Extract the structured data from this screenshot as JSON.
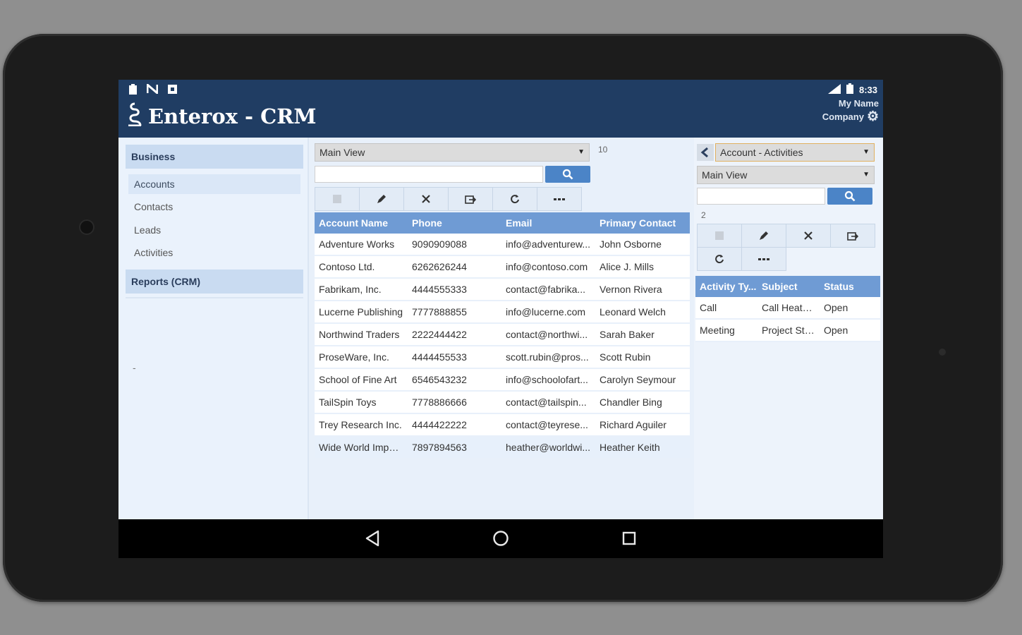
{
  "status_bar": {
    "time": "8:33",
    "left_icons": [
      "clipboard-icon",
      "n-icon",
      "square-icon"
    ],
    "right_icons": [
      "signal-icon",
      "battery-icon"
    ]
  },
  "header": {
    "title": "Enterox - CRM",
    "user_name": "My Name",
    "company": "Company"
  },
  "sidebar": {
    "section_business": "Business",
    "items": [
      {
        "label": "Accounts"
      },
      {
        "label": "Contacts"
      },
      {
        "label": "Leads"
      },
      {
        "label": "Activities"
      }
    ],
    "section_reports": "Reports (CRM)",
    "dash": "-"
  },
  "main": {
    "view_select": "Main View",
    "search_value": "",
    "record_count": "10",
    "columns": [
      "Account Name",
      "Phone",
      "Email",
      "Primary Contact"
    ],
    "rows": [
      {
        "name": "Adventure Works",
        "phone": "9090909088",
        "email": "info@adventurew...",
        "contact": "John Osborne"
      },
      {
        "name": "Contoso Ltd.",
        "phone": "6262626244",
        "email": "info@contoso.com",
        "contact": "Alice J. Mills"
      },
      {
        "name": "Fabrikam, Inc.",
        "phone": "4444555333",
        "email": "contact@fabrika...",
        "contact": "Vernon Rivera"
      },
      {
        "name": "Lucerne Publishing",
        "phone": "7777888855",
        "email": "info@lucerne.com",
        "contact": "Leonard Welch"
      },
      {
        "name": "Northwind Traders",
        "phone": "2222444422",
        "email": "contact@northwi...",
        "contact": "Sarah Baker"
      },
      {
        "name": "ProseWare, Inc.",
        "phone": "4444455533",
        "email": "scott.rubin@pros...",
        "contact": "Scott Rubin"
      },
      {
        "name": "School of Fine Art",
        "phone": "6546543232",
        "email": "info@schoolofart...",
        "contact": "Carolyn Seymour"
      },
      {
        "name": "TailSpin Toys",
        "phone": "7778886666",
        "email": "contact@tailspin...",
        "contact": "Chandler Bing"
      },
      {
        "name": "Trey Research Inc.",
        "phone": "4444422222",
        "email": "contact@teyrese...",
        "contact": "Richard Aguiler"
      },
      {
        "name": "Wide World Impor...",
        "phone": "7897894563",
        "email": "heather@worldwi...",
        "contact": "Heather Keith"
      }
    ]
  },
  "right_panel": {
    "related_select": "Account - Activities",
    "view_select": "Main View",
    "search_value": "",
    "record_count": "2",
    "columns": [
      "Activity Ty...",
      "Subject",
      "Status"
    ],
    "rows": [
      {
        "type": "Call",
        "subject": "Call Heath...",
        "status": "Open"
      },
      {
        "type": "Meeting",
        "subject": "Project Sta...",
        "status": "Open"
      }
    ]
  },
  "toolbar_icons": {
    "new": "new-record-icon",
    "edit": "pencil-icon",
    "delete": "close-icon",
    "export": "export-icon",
    "refresh": "refresh-icon",
    "more": "more-icon"
  },
  "colors": {
    "header_bg": "#203d63",
    "table_header": "#6f9bd4",
    "search_button": "#4b84c7",
    "sidebar_section": "#c9dbf1"
  }
}
